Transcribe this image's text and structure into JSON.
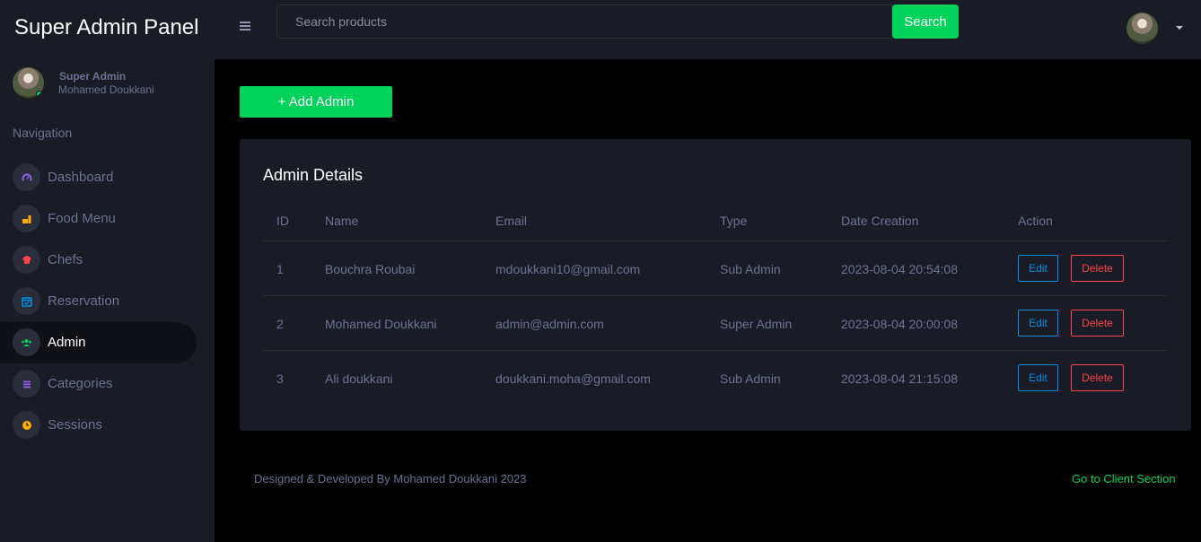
{
  "brand": "Super Admin Panel",
  "profile": {
    "role": "Super Admin",
    "name": "Mohamed Doukkani"
  },
  "nav_title": "Navigation",
  "nav": [
    {
      "label": "Dashboard",
      "icon": "speedometer-icon",
      "color": "#8f5fe8"
    },
    {
      "label": "Food Menu",
      "icon": "food-icon",
      "color": "#ffab00"
    },
    {
      "label": "Chefs",
      "icon": "chef-hat-icon",
      "color": "#fc424a"
    },
    {
      "label": "Reservation",
      "icon": "calendar-check-icon",
      "color": "#0090e7"
    },
    {
      "label": "Admin",
      "icon": "users-icon",
      "color": "#00d25b",
      "active": true
    },
    {
      "label": "Categories",
      "icon": "list-icon",
      "color": "#8f5fe8"
    },
    {
      "label": "Sessions",
      "icon": "clock-icon",
      "color": "#ffab00"
    }
  ],
  "search": {
    "placeholder": "Search products",
    "button": "Search"
  },
  "add_button": "+ Add Admin",
  "card_title": "Admin Details",
  "table": {
    "headers": [
      "ID",
      "Name",
      "Email",
      "Type",
      "Date Creation",
      "Action"
    ],
    "rows": [
      {
        "id": "1",
        "name": "Bouchra Roubai",
        "email": "mdoukkani10@gmail.com",
        "type": "Sub Admin",
        "date": "2023-08-04 20:54:08"
      },
      {
        "id": "2",
        "name": "Mohamed Doukkani",
        "email": "admin@admin.com",
        "type": "Super Admin",
        "date": "2023-08-04 20:00:08"
      },
      {
        "id": "3",
        "name": "Ali doukkani",
        "email": "doukkani.moha@gmail.com",
        "type": "Sub Admin",
        "date": "2023-08-04 21:15:08"
      }
    ],
    "edit_label": "Edit",
    "delete_label": "Delete"
  },
  "footer": {
    "text": "Designed & Developed By Mohamed Doukkani 2023",
    "link": "Go to Client Section"
  },
  "colors": {
    "accent": "#00d25b",
    "sidebar_bg": "#191c24",
    "info": "#0090e7",
    "danger": "#fc424a"
  }
}
